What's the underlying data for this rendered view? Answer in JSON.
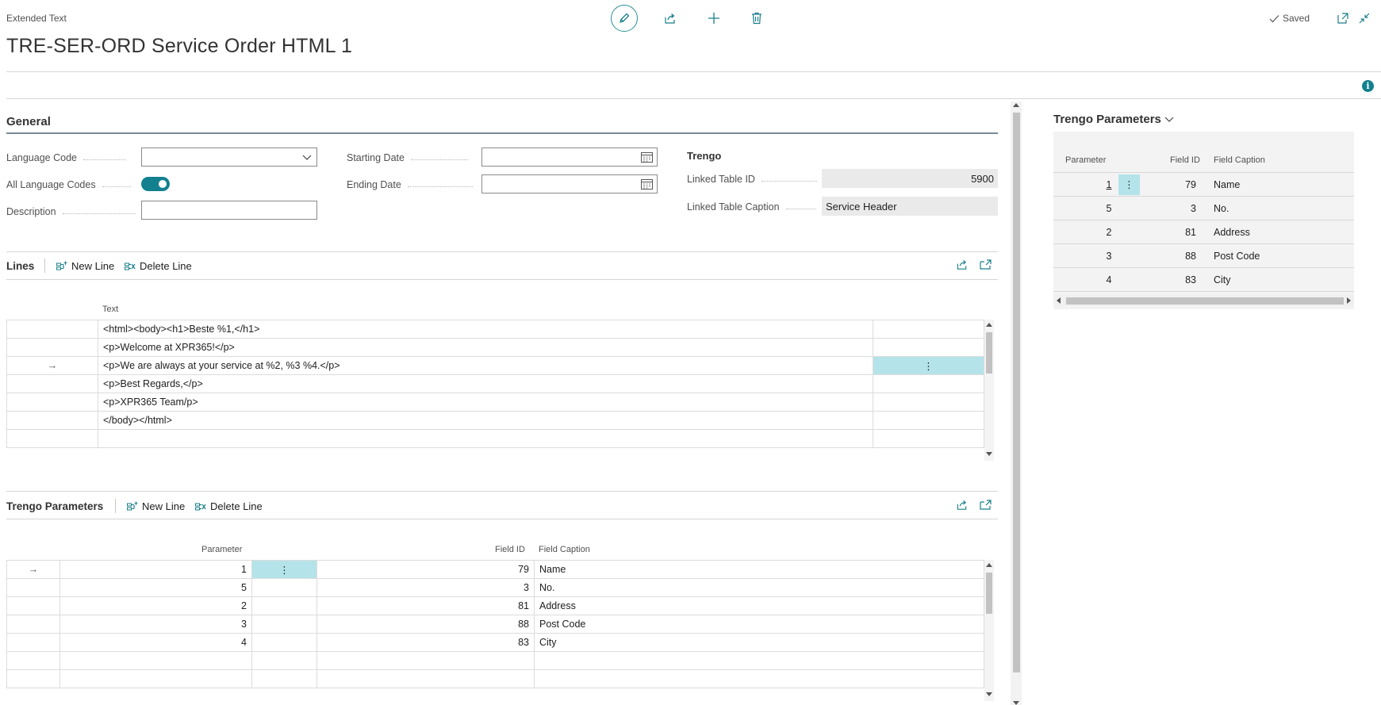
{
  "header": {
    "caption": "Extended Text",
    "title": "TRE-SER-ORD Service Order HTML 1",
    "saved_label": "Saved"
  },
  "general": {
    "section_title": "General",
    "language_code_label": "Language Code",
    "language_code_value": "",
    "all_language_codes_label": "All Language Codes",
    "all_language_codes_value": true,
    "description_label": "Description",
    "description_value": "",
    "starting_date_label": "Starting Date",
    "starting_date_value": "",
    "ending_date_label": "Ending Date",
    "ending_date_value": "",
    "trengo_group_label": "Trengo",
    "linked_table_id_label": "Linked Table ID",
    "linked_table_id_value": "5900",
    "linked_table_caption_label": "Linked Table Caption",
    "linked_table_caption_value": "Service Header"
  },
  "lines": {
    "title": "Lines",
    "new_line_label": "New Line",
    "delete_line_label": "Delete Line",
    "column_text": "Text",
    "rows": [
      "<html><body><h1>Beste %1,</h1>",
      "<p>Welcome at XPR365!</p>",
      "<p>We are always at your service at %2, %3 %4.</p>",
      "<p>Best Regards,</p>",
      "<p>XPR365 Team/p>",
      "</body></html>"
    ],
    "selected_row_index": 2
  },
  "trengo_parameters": {
    "title": "Trengo Parameters",
    "new_line_label": "New Line",
    "delete_line_label": "Delete Line",
    "column_parameter": "Parameter",
    "column_field_id": "Field ID",
    "column_field_caption": "Field Caption",
    "rows": [
      {
        "parameter": "1",
        "field_id": "79",
        "field_caption": "Name"
      },
      {
        "parameter": "5",
        "field_id": "3",
        "field_caption": "No."
      },
      {
        "parameter": "2",
        "field_id": "81",
        "field_caption": "Address"
      },
      {
        "parameter": "3",
        "field_id": "88",
        "field_caption": "Post Code"
      },
      {
        "parameter": "4",
        "field_id": "83",
        "field_caption": "City"
      }
    ]
  },
  "factbox": {
    "title": "Trengo Parameters",
    "column_parameter": "Parameter",
    "column_field_id": "Field ID",
    "column_field_caption": "Field Caption",
    "rows": [
      {
        "parameter": "1",
        "field_id": "79",
        "field_caption": "Name"
      },
      {
        "parameter": "5",
        "field_id": "3",
        "field_caption": "No."
      },
      {
        "parameter": "2",
        "field_id": "81",
        "field_caption": "Address"
      },
      {
        "parameter": "3",
        "field_id": "88",
        "field_caption": "Post Code"
      },
      {
        "parameter": "4",
        "field_id": "83",
        "field_caption": "City"
      }
    ]
  },
  "icons": {
    "edit": "pencil-icon",
    "share": "share-icon",
    "new": "plus-icon",
    "delete": "trash-icon",
    "saved": "checkmark-icon",
    "open_new_window": "open-in-new-window-icon",
    "collapse": "collapse-icon",
    "info": "info-icon",
    "calendar": "calendar-icon",
    "dropdown": "chevron-down-icon",
    "row_arrow": "arrow-right-icon",
    "row_menu": "ellipsis-vertical-icon"
  },
  "colors": {
    "accent": "#12808f",
    "selection": "#b4e4e9",
    "readonly_field": "#eaeaea",
    "factbox_bg": "#f3f3f3"
  }
}
